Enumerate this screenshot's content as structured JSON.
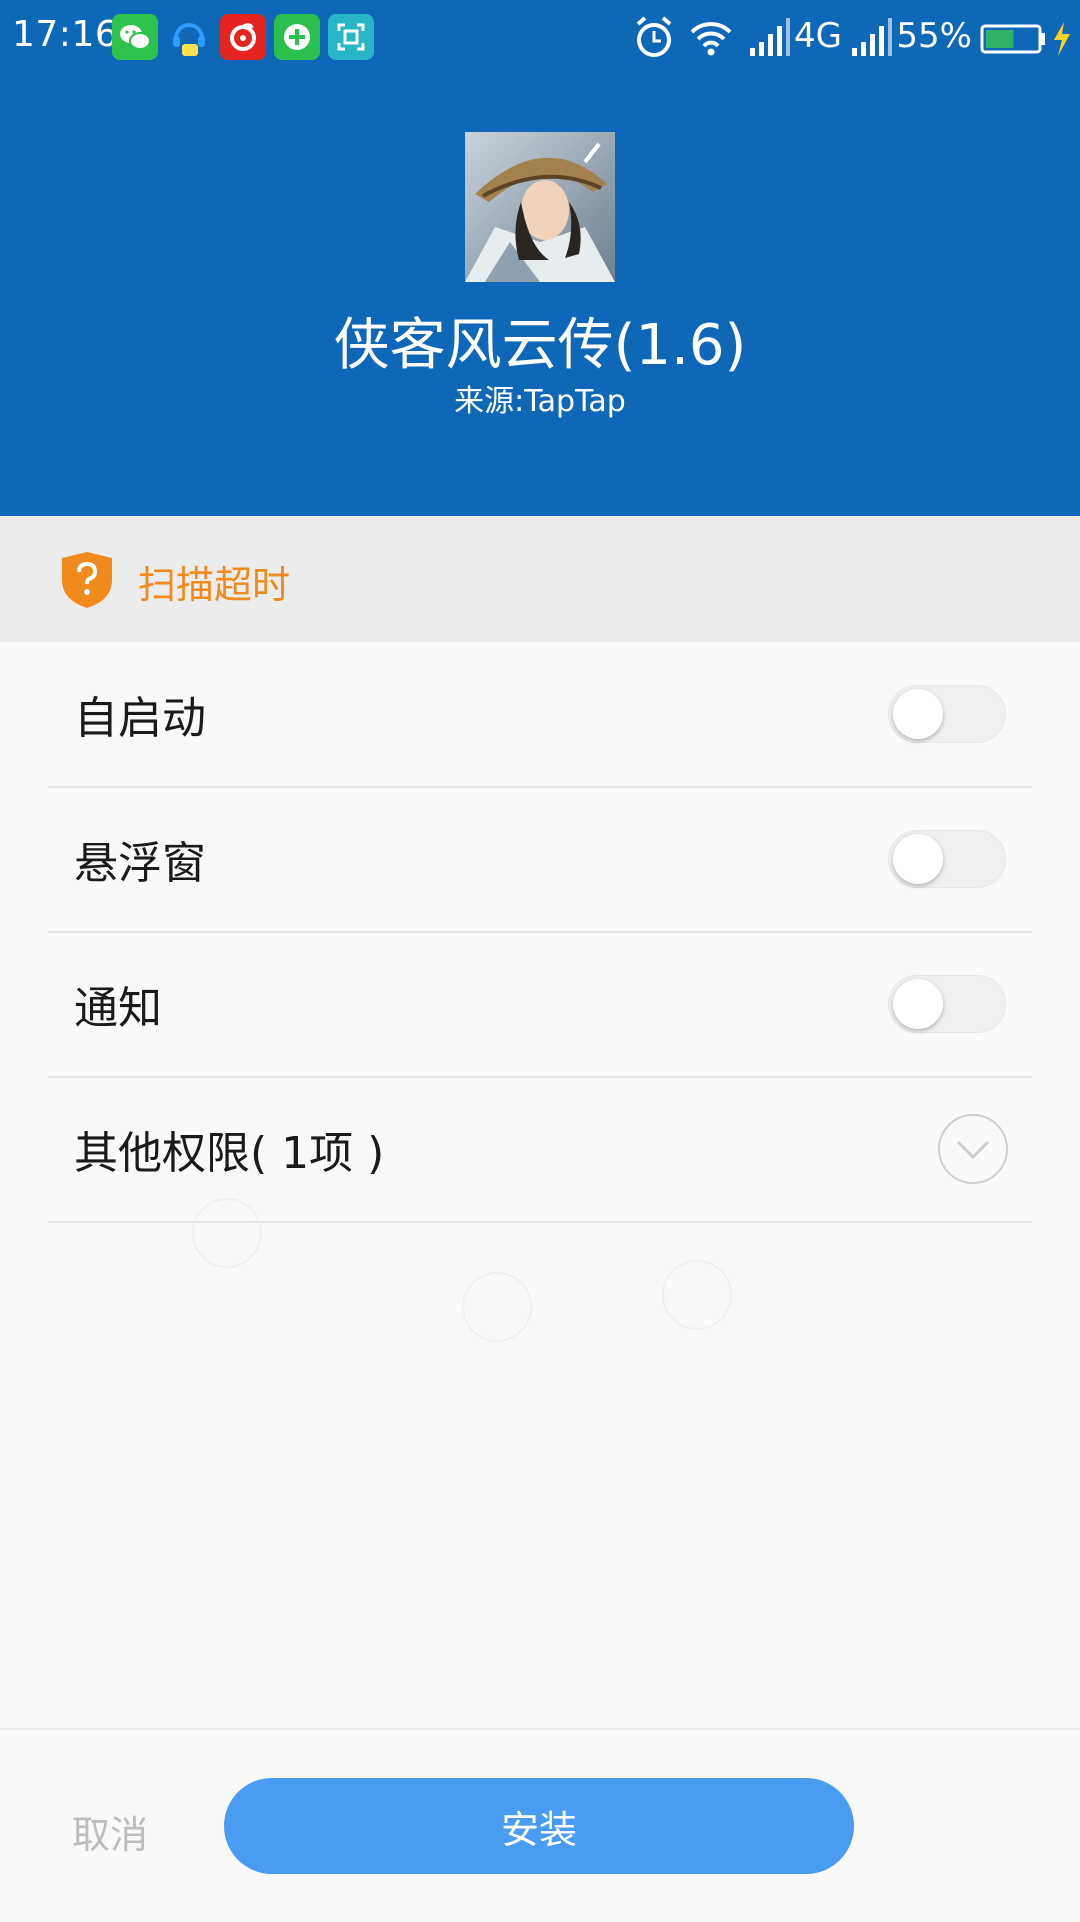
{
  "status_bar": {
    "time": "17:16",
    "network_label": "4G",
    "battery_percent": "55%",
    "battery_level": 0.55,
    "notification_icons": [
      "wechat-icon",
      "qq-icon",
      "netease-music-icon",
      "add-app-icon",
      "scan-app-icon"
    ],
    "status_icons": [
      "alarm-icon",
      "wifi-icon",
      "signal-icon",
      "signal-icon",
      "battery-icon",
      "charging-icon"
    ]
  },
  "app": {
    "name": "侠客风云传(1.6)",
    "source": "来源:TapTap"
  },
  "scan": {
    "status_text": "扫描超时",
    "icon": "shield-question-icon",
    "color": "#f08a1c"
  },
  "permissions": [
    {
      "label": "自启动",
      "enabled": false
    },
    {
      "label": "悬浮窗",
      "enabled": false
    },
    {
      "label": "通知",
      "enabled": false
    }
  ],
  "other_permissions": {
    "label": "其他权限( 1项 )",
    "icon": "chevron-down-icon"
  },
  "footer": {
    "cancel_label": "取消",
    "install_label": "安装"
  },
  "colors": {
    "header_bg": "#0f67b7",
    "install_button": "#4a9bf2",
    "battery_fill": "#2fb36b"
  }
}
